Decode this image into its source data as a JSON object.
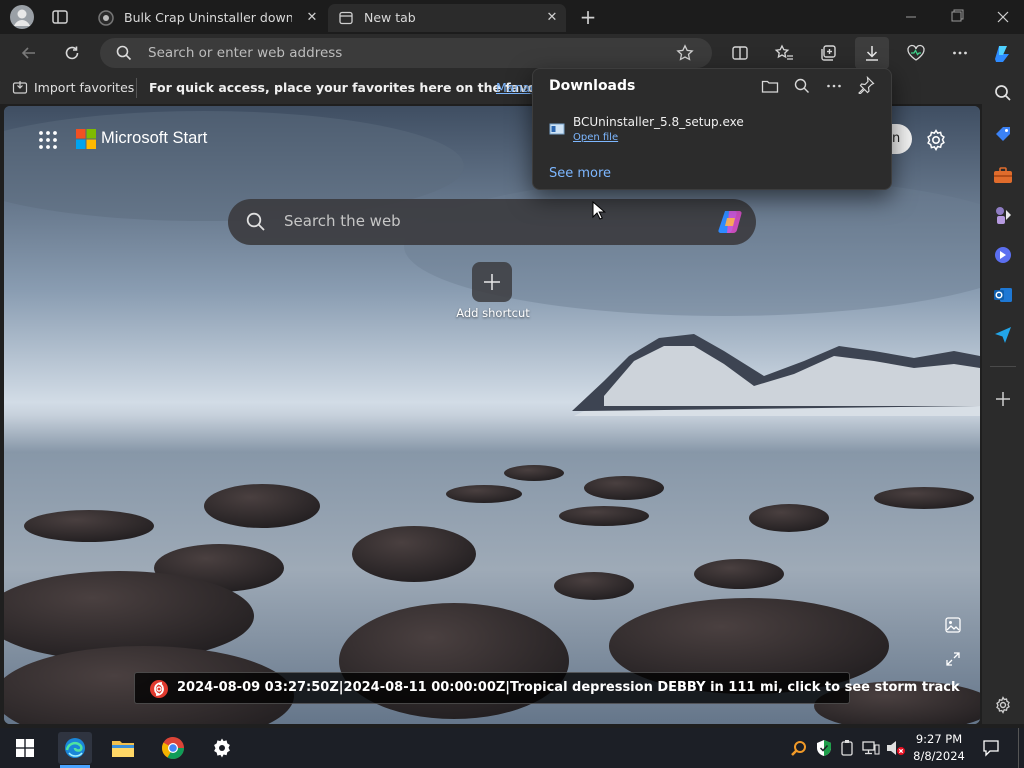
{
  "browser": {
    "tabs": [
      {
        "title": "Bulk Crap Uninstaller download f",
        "active": false
      },
      {
        "title": "New tab",
        "active": true
      }
    ],
    "address_placeholder": "Search or enter web address"
  },
  "favorites_bar": {
    "import_label": "Import favorites",
    "hint": "For quick access, place your favorites here on the favorites bar.",
    "manage_link": "Manage"
  },
  "downloads": {
    "title": "Downloads",
    "items": [
      {
        "filename": "BCUninstaller_5.8_setup.exe",
        "action": "Open file"
      }
    ],
    "see_more": "See more"
  },
  "new_tab": {
    "brand": "Microsoft Start",
    "search_placeholder": "Search the web",
    "add_shortcut": "Add shortcut",
    "signin_fragment": "n",
    "news_ticker": "2024-08-09 03:27:50Z|2024-08-11 00:00:00Z|Tropical depression DEBBY in 111 mi, click to see storm track"
  },
  "taskbar": {
    "time": "9:27 PM",
    "date": "8/8/2024"
  },
  "colors": {
    "accent_blue": "#4aa3ff",
    "link": "#7db7ff"
  }
}
